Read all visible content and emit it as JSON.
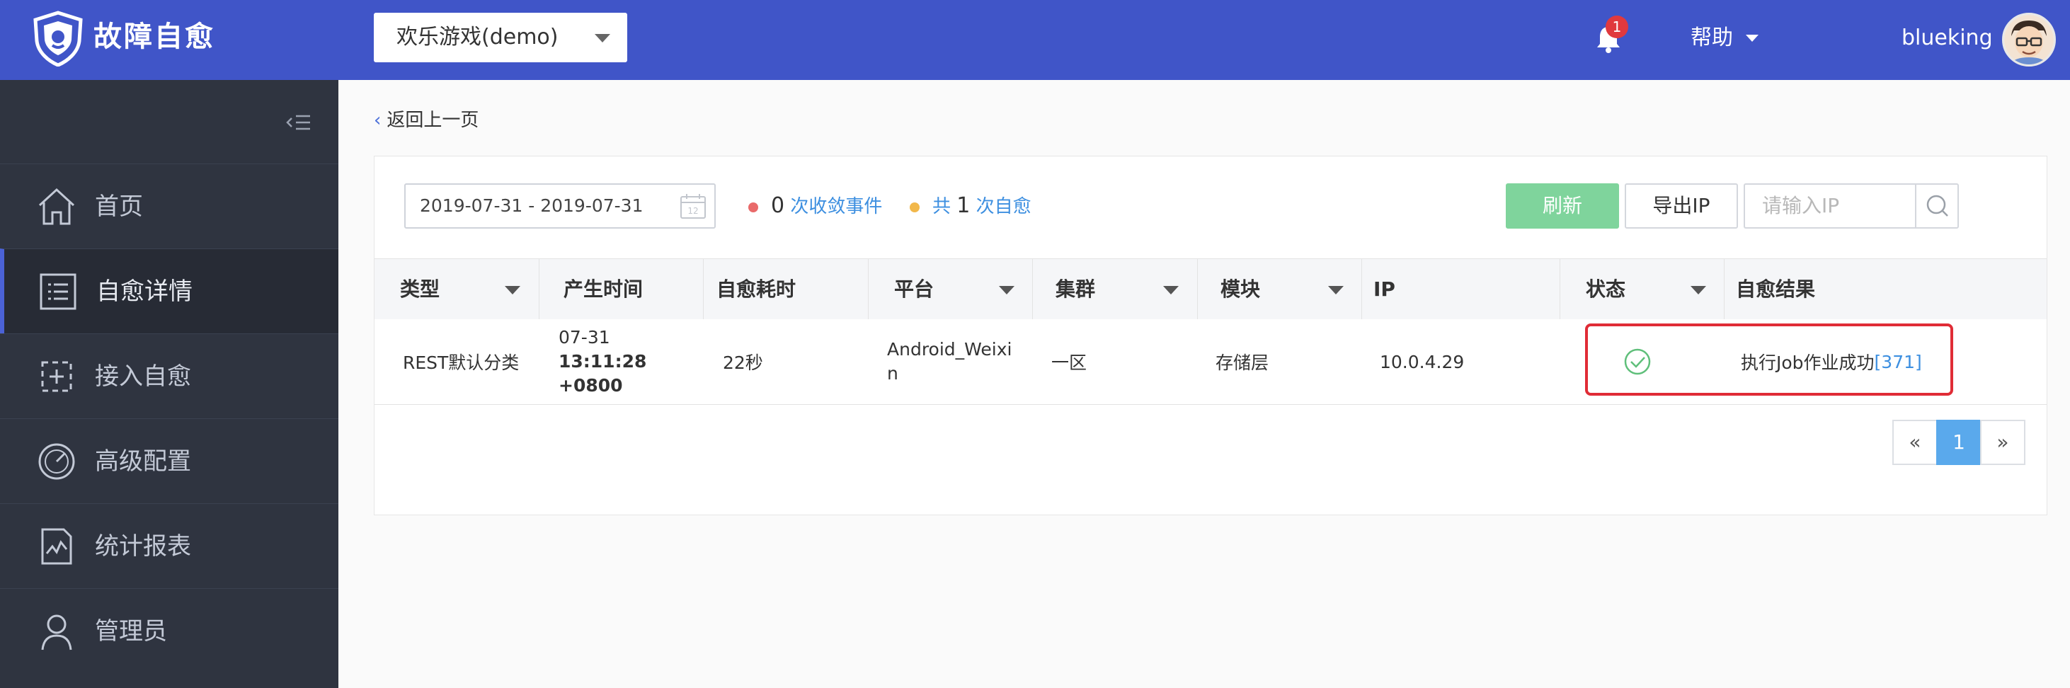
{
  "app": {
    "title": "故障自愈",
    "business": "欢乐游戏(demo)"
  },
  "header": {
    "notification_count": "1",
    "help_label": "帮助",
    "username": "blueking"
  },
  "sidebar": {
    "items": [
      {
        "label": "首页",
        "icon": "home-icon"
      },
      {
        "label": "自愈详情",
        "icon": "list-icon",
        "active": true
      },
      {
        "label": "接入自愈",
        "icon": "access-icon"
      },
      {
        "label": "高级配置",
        "icon": "gauge-icon"
      },
      {
        "label": "统计报表",
        "icon": "report-icon"
      },
      {
        "label": "管理员",
        "icon": "user-icon"
      }
    ]
  },
  "main": {
    "back_label": "返回上一页",
    "date_range": "2019-07-31 - 2019-07-31",
    "converge": {
      "count": "0",
      "label": "次收敛事件",
      "color": "#e96a6a"
    },
    "heal": {
      "prefix": "共",
      "count": "1",
      "label": "次自愈",
      "color": "#f2b84b"
    },
    "refresh_label": "刷新",
    "export_label": "导出IP",
    "ip_placeholder": "请输入IP"
  },
  "table": {
    "headers": [
      "类型",
      "产生时间",
      "自愈耗时",
      "平台",
      "集群",
      "模块",
      "IP",
      "状态",
      "自愈结果"
    ],
    "rows": [
      {
        "type": "REST默认分类",
        "date": "07-31",
        "time": "13:11:28",
        "tz": "+0800",
        "duration": "22秒",
        "platform": "Android_Weixin",
        "cluster": "一区",
        "module": "存储层",
        "ip": "10.0.4.29",
        "status": "success",
        "result": "执行Job作业成功",
        "result_link": "[371]"
      }
    ]
  },
  "pagination": {
    "prev": "«",
    "current": "1",
    "next": "»"
  },
  "colors": {
    "topbar": "#4055c8",
    "sidebar": "#2f3440",
    "refresh": "#7fd49c",
    "highlight": "#e02c36",
    "page_active": "#5aa9ec"
  }
}
